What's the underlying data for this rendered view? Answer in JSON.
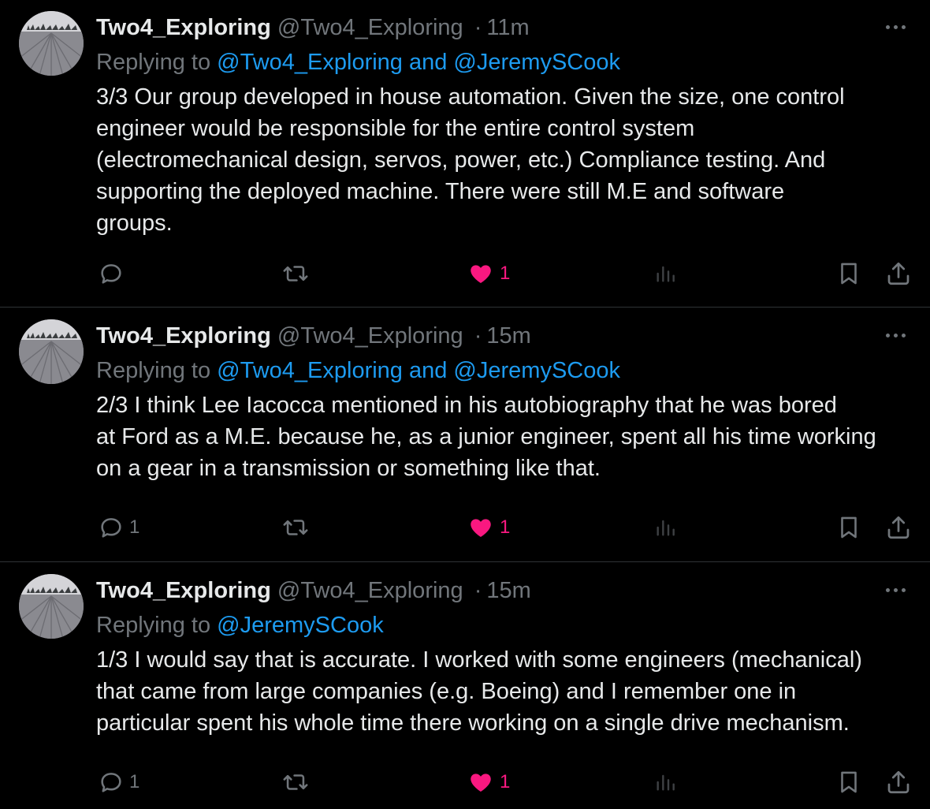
{
  "tweets": [
    {
      "display_name": "Two4_Exploring",
      "handle": "@Two4_Exploring",
      "separator": "·",
      "time": "11m",
      "replying_prefix": "Replying to",
      "replying_to": "@Two4_Exploring and @JeremySCook",
      "text_lines": [
        "3/3 Our group developed in house automation. Given the size, one control",
        "engineer would be responsible for the entire control system",
        "(electromechanical design, servos, power, etc.) Compliance testing. And",
        "supporting the deployed machine. There were still M.E and software",
        "groups."
      ],
      "reply_count": "",
      "repost_count": "",
      "like_count": "1"
    },
    {
      "display_name": "Two4_Exploring",
      "handle": "@Two4_Exploring",
      "separator": "·",
      "time": "15m",
      "replying_prefix": "Replying to",
      "replying_to": "@Two4_Exploring and @JeremySCook",
      "text_lines": [
        "2/3 I think Lee Iacocca mentioned in his autobiography that he was bored",
        "at Ford as a M.E. because he, as a junior engineer, spent all his time working",
        "on a gear in a transmission or something like that."
      ],
      "reply_count": "1",
      "repost_count": "",
      "like_count": "1"
    },
    {
      "display_name": "Two4_Exploring",
      "handle": "@Two4_Exploring",
      "separator": "·",
      "time": "15m",
      "replying_prefix": "Replying to",
      "replying_to": "@JeremySCook",
      "text_lines": [
        "1/3 I would say that is accurate. I worked with some engineers (mechanical)",
        "that came from large companies (e.g. Boeing) and I remember one in",
        "particular spent his whole time there working on a single drive mechanism."
      ],
      "reply_count": "1",
      "repost_count": "",
      "like_count": "1"
    }
  ],
  "icons": {
    "reply": "reply-icon",
    "repost": "repost-icon",
    "like": "heart-icon",
    "views": "views-icon",
    "bookmark": "bookmark-icon",
    "share": "share-icon",
    "more": "more-icon"
  },
  "colors": {
    "background": "#000000",
    "text": "#e7e9ea",
    "muted": "#71767b",
    "link": "#1d9bf0",
    "like": "#f91880",
    "divider": "#2f3336"
  }
}
